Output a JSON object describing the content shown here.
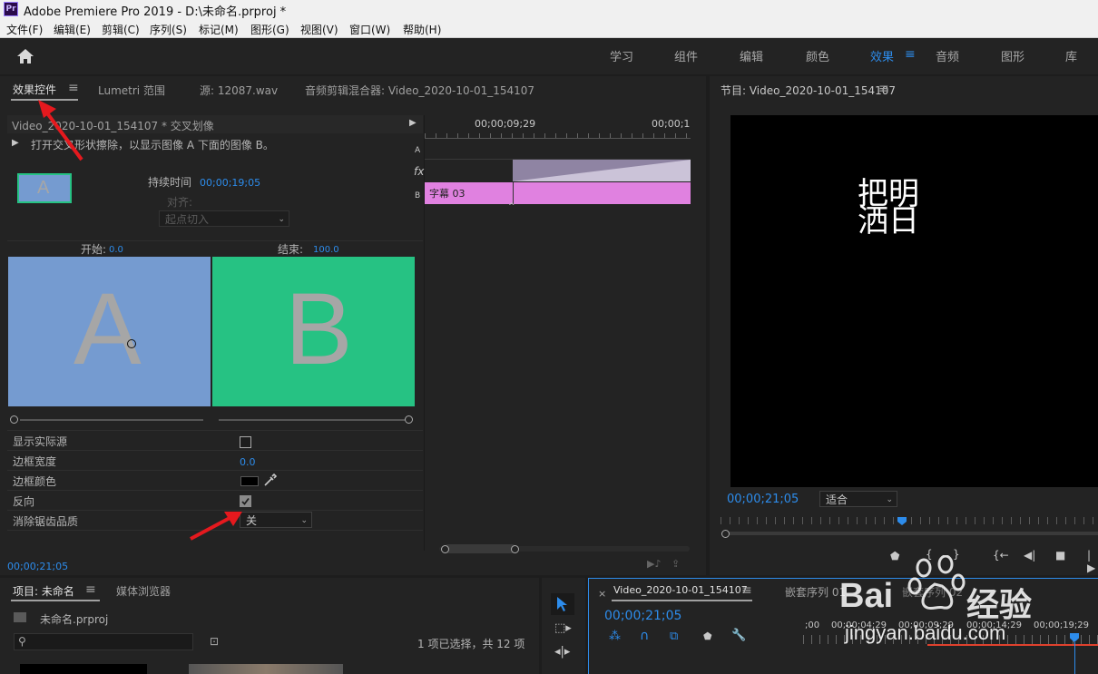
{
  "app": {
    "logo": "Pr",
    "title": "Adobe Premiere Pro 2019 - D:\\未命名.prproj *"
  },
  "menu": [
    "文件(F)",
    "编辑(E)",
    "剪辑(C)",
    "序列(S)",
    "标记(M)",
    "图形(G)",
    "视图(V)",
    "窗口(W)",
    "帮助(H)"
  ],
  "workspaces": [
    "学习",
    "组件",
    "编辑",
    "颜色",
    "效果",
    "音频",
    "图形",
    "库"
  ],
  "workspace_active": "效果",
  "source_panel": {
    "tabs": [
      "效果控件",
      "Lumetri 范围",
      "源: 12087.wav",
      "音频剪辑混合器: Video_2020-10-01_154107"
    ],
    "clip_header": "Video_2020-10-01_154107 * 交叉划像",
    "description": "打开交叉形状擦除，以显示图像 A 下面的图像 B。",
    "duration_label": "持续时间",
    "duration_value": "00;00;19;05",
    "align_label": "对齐:",
    "align_value": "起点切入",
    "thumb_letter": "A",
    "start_label": "开始:",
    "start_value": "0.0",
    "end_label": "结束:",
    "end_value": "100.0",
    "preview_a": "A",
    "preview_b": "B",
    "props": {
      "show_actual": "显示实际源",
      "border_width": "边框宽度",
      "border_width_value": "0.0",
      "border_color": "边框颜色",
      "reverse": "反向",
      "antialias": "消除锯齿品质",
      "antialias_value": "关"
    },
    "timecode": "00;00;21;05",
    "timeline_ruler": [
      "00;00;09;29",
      "00;00;1"
    ],
    "track_a": "A",
    "track_b": "B",
    "fx": "fx",
    "clip_name": "字幕 03",
    "colors": {
      "a_preview": "#759bd0",
      "b_preview": "#26c283",
      "letter": "#a6a6a6"
    }
  },
  "program": {
    "title": "节目: Video_2020-10-01_154107",
    "caption_line1": "把明",
    "caption_line2": "洒日",
    "timecode": "00;00;21;05",
    "fit": "适合"
  },
  "project": {
    "tabs": [
      "项目: 未命名",
      "媒体浏览器"
    ],
    "file": "未命名.prproj",
    "selection": "1 项已选择，共 12 项"
  },
  "timeline": {
    "tab": "Video_2020-10-01_154107",
    "tab2": "嵌套序列 01",
    "tab3": "嵌套序列 02",
    "timecode": "00;00;21;05",
    "ruler": [
      ";00",
      "00;00;04;29",
      "00;00;09;29",
      "00;00;14;29",
      "00;00;19;29"
    ]
  },
  "watermark": {
    "brand": "Bai",
    "brand2": "经验",
    "url": "jingyan.baidu.com"
  }
}
